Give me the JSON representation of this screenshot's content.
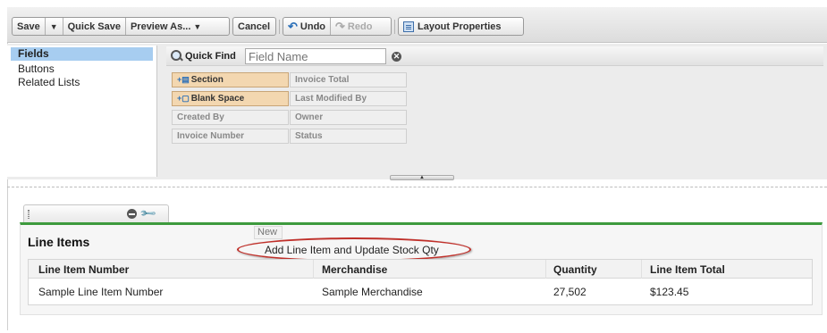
{
  "toolbar": {
    "save_label": "Save",
    "save_dropdown_label": "▼",
    "quick_save_label": "Quick Save",
    "preview_as_label": "Preview As...",
    "cancel_label": "Cancel",
    "undo_label": "Undo",
    "redo_label": "Redo",
    "layout_properties_label": "Layout Properties"
  },
  "palette": {
    "categories": [
      "Fields",
      "Buttons",
      "Related Lists"
    ],
    "selected_category": "Fields",
    "quick_find_label": "Quick Find",
    "quick_find_placeholder": "Field Name",
    "fields": [
      "Section",
      "Invoice Total",
      "Blank Space",
      "Last Modified By",
      "Created By",
      "Owner",
      "Invoice Number",
      "Status"
    ]
  },
  "related_list": {
    "new_button_label": "New",
    "custom_button_label": "Add Line Item and Update Stock Qty",
    "title": "Line Items",
    "columns": [
      "Line Item Number",
      "Merchandise",
      "Quantity",
      "Line Item Total"
    ],
    "rows": [
      [
        "Sample Line Item Number",
        "Sample Merchandise",
        "27,502",
        "$123.45"
      ]
    ]
  },
  "colors": {
    "section_border": "#3d9a3d",
    "selected_category_bg": "#a7cdf0",
    "special_tile_bg": "#f3d7b0",
    "highlight_ellipse": "#c0302a"
  },
  "icons": [
    "magnifier-icon",
    "clear-icon",
    "undo-icon",
    "redo-icon",
    "layout-properties-icon",
    "minus-icon",
    "wrench-icon",
    "grip-icon"
  ]
}
